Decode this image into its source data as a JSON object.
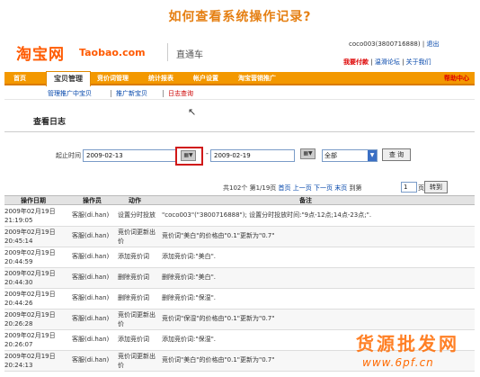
{
  "page_question": "如何查看系统操作记录?",
  "header": {
    "logo_zh": "淘宝网",
    "logo_en": "Taobao.com",
    "product": "直通车",
    "user_name": "coco003(3800716888)",
    "user_link": "退出",
    "top_links": [
      "我要付款",
      "温滑论坛",
      "关于我们"
    ]
  },
  "nav": {
    "items": [
      "首页",
      "宝贝管理",
      "竞价词管理",
      "统计报表",
      "帐户设置",
      "淘宝营销推广"
    ],
    "active_index": 1,
    "right_link": "帮助中心"
  },
  "subnav": {
    "items": [
      "管理推广中宝贝",
      "推广新宝贝",
      "日志查询"
    ],
    "active_index": 2
  },
  "section_title": "查看日志",
  "filter": {
    "label": "起止时间",
    "start_date": "2009-02-13",
    "end_date": "2009-02-19",
    "calendar_glyph": "▦▼",
    "type_select": "全部",
    "query_button": "查 询"
  },
  "pager": {
    "text_total": "共102个 第1/19页",
    "first": "首页",
    "prev": "上一页",
    "next": "下一页",
    "last": "末页",
    "goto_label": "到第",
    "page_value": "1",
    "page_unit": "页",
    "go_button": "转到"
  },
  "table": {
    "columns": [
      "操作日期",
      "操作员",
      "动作",
      "备注"
    ],
    "rows": [
      {
        "date": [
          "2009年02月19日",
          "21:19:05"
        ],
        "operator": "客服(di.han)",
        "action": [
          "设置分时投放"
        ],
        "note": "\"coco003\"(\"3800716888\"); 设置分时投放时间:\"9点-12点;14点-23点;\"."
      },
      {
        "date": [
          "2009年02月19日",
          "20:45:14"
        ],
        "operator": "客服(di.han)",
        "action": [
          "竞价词更新出",
          "价"
        ],
        "note": "竞价词\"美白\"的价格由\"0.1\"更新为\"0.7\""
      },
      {
        "date": [
          "2009年02月19日",
          "20:44:59"
        ],
        "operator": "客服(di.han)",
        "action": [
          "添加竞价词"
        ],
        "note": "添加竞价词:\"美白\"."
      },
      {
        "date": [
          "2009年02月19日",
          "20:44:30"
        ],
        "operator": "客服(di.han)",
        "action": [
          "删除竞价词"
        ],
        "note": "删除竞价词:\"美白\"."
      },
      {
        "date": [
          "2009年02月19日",
          "20:44:26"
        ],
        "operator": "客服(di.han)",
        "action": [
          "删除竞价词"
        ],
        "note": "删除竞价词:\"保湿\"."
      },
      {
        "date": [
          "2009年02月19日",
          "20:26:28"
        ],
        "operator": "客服(di.han)",
        "action": [
          "竞价词更新出",
          "价"
        ],
        "note": "竞价词\"保湿\"的价格由\"0.1\"更新为\"0.7\""
      },
      {
        "date": [
          "2009年02月19日",
          "20:26:07"
        ],
        "operator": "客服(di.han)",
        "action": [
          "添加竞价词"
        ],
        "note": "添加竞价词:\"保湿\"."
      },
      {
        "date": [
          "2009年02月19日",
          "20:24:13"
        ],
        "operator": "客服(di.han)",
        "action": [
          "竞价词更新出",
          "价"
        ],
        "note": "竞价词\"美白\"的价格由\"0.1\"更新为\"0.7\""
      }
    ]
  },
  "watermark": {
    "text": "货源批发网",
    "url": "www.6pf.cn"
  }
}
